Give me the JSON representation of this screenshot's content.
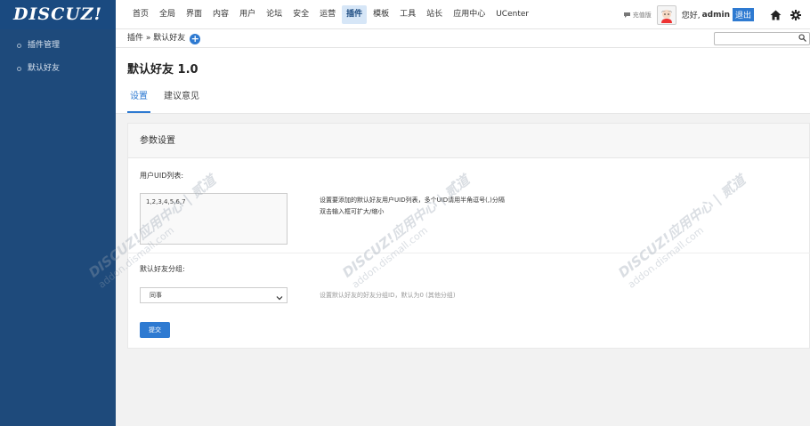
{
  "brand": {
    "logo_text": "DISCUZ!"
  },
  "topnav": {
    "items": [
      {
        "label": "首页"
      },
      {
        "label": "全局"
      },
      {
        "label": "界面"
      },
      {
        "label": "内容"
      },
      {
        "label": "用户"
      },
      {
        "label": "论坛"
      },
      {
        "label": "安全"
      },
      {
        "label": "运营"
      },
      {
        "label": "插件",
        "active": true
      },
      {
        "label": "模板"
      },
      {
        "label": "工具"
      },
      {
        "label": "站长"
      },
      {
        "label": "应用中心"
      },
      {
        "label": "UCenter"
      }
    ]
  },
  "user": {
    "mini_label": "充值版",
    "greeting": "您好,",
    "name": "admin",
    "logout_label": "退出"
  },
  "sidebar": {
    "items": [
      {
        "label": "插件管理"
      },
      {
        "label": "默认好友"
      }
    ]
  },
  "breadcrumb": {
    "text": "插件 » 默认好友"
  },
  "search": {
    "placeholder": ""
  },
  "page": {
    "title": "默认好友 1.0",
    "tabs": [
      {
        "label": "设置",
        "active": true
      },
      {
        "label": "建议意见"
      }
    ]
  },
  "panel": {
    "title": "参数设置",
    "uid_label": "用户UID列表:",
    "uid_value": "1,2,3,4,5,6,7",
    "uid_tip_line1": "设置要添加的默认好友用户UID列表，多个UID请用半角逗号(,)分隔",
    "uid_tip_line2": "双击输入框可扩大/缩小",
    "group_label": "默认好友分组:",
    "group_selected": "同事",
    "group_tip": "设置默认好友的好友分组ID，默认为0 (其他分组)",
    "submit_label": "提交"
  },
  "watermark": {
    "text": "DISCUZ!应用中心 | 贰道",
    "sub": "addon.dismall.com"
  },
  "colors": {
    "sidebar_bg": "#1e4a7b",
    "accent": "#2e7ad1",
    "page_bg": "#f2f2f2"
  }
}
